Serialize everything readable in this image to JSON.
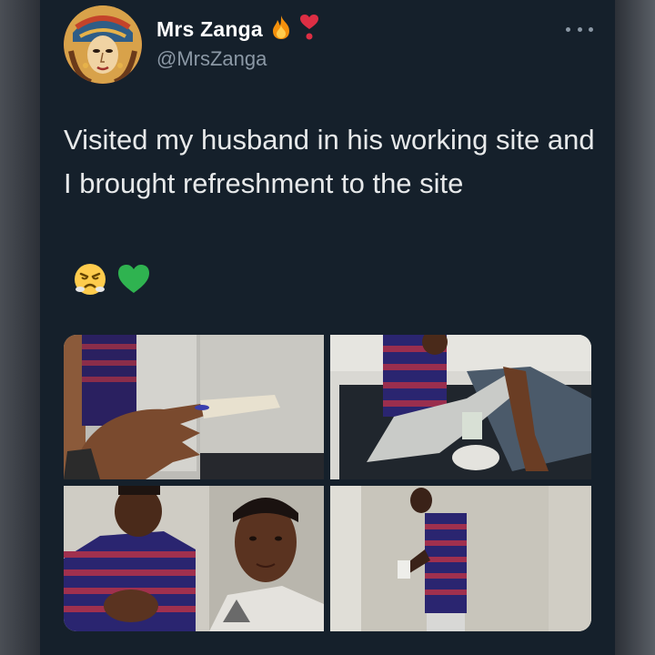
{
  "tweet": {
    "author": {
      "display_name": "Mrs Zanga",
      "handle": "@MrsZanga",
      "name_emojis": [
        "fire-icon",
        "heart-exclamation-icon"
      ]
    },
    "text": "Visited my husband in his working site and I brought refreshment to the site",
    "emojis": [
      "angry-face-icon",
      "green-heart-icon"
    ],
    "media": [
      {
        "name": "photo-hand-with-fried-snack"
      },
      {
        "name": "photo-man-plastering-on-floor"
      },
      {
        "name": "photo-couple-selfie"
      },
      {
        "name": "photo-man-standing-at-wall"
      }
    ]
  },
  "colors": {
    "background": "#15202b",
    "text_primary": "#e7e9ea",
    "text_secondary": "#8b98a5"
  }
}
